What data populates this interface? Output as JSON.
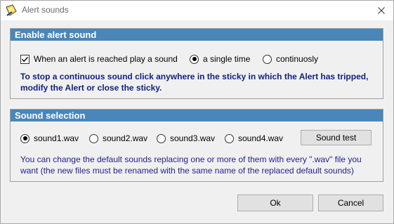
{
  "window": {
    "title": "Alert sounds",
    "close_icon": "close-icon",
    "app_icon": "sticky-note-icon"
  },
  "enable_group": {
    "header": "Enable alert sound",
    "checkbox_label": "When an alert is reached play a sound",
    "checkbox_checked": true,
    "options": [
      {
        "label": "a single time",
        "selected": true
      },
      {
        "label": "continuosly",
        "selected": false
      }
    ],
    "info": "To stop a continuous sound click anywhere in the sticky in which the Alert has tripped, modify the Alert or close the sticky."
  },
  "sound_group": {
    "header": "Sound selection",
    "sounds": [
      {
        "label": "sound1.wav",
        "selected": true
      },
      {
        "label": "sound2.wav",
        "selected": false
      },
      {
        "label": "sound3.wav",
        "selected": false
      },
      {
        "label": "sound4.wav",
        "selected": false
      }
    ],
    "test_button": "Sound test",
    "info": "You can change the default sounds replacing one or more of them with every \".wav\" file you want  (the new files must be renamed with the same name of the replaced default sounds)"
  },
  "footer": {
    "ok_label": "Ok",
    "cancel_label": "Cancel"
  },
  "colors": {
    "group_header": "#4a86b8",
    "info_text": "#1f1f8f"
  }
}
